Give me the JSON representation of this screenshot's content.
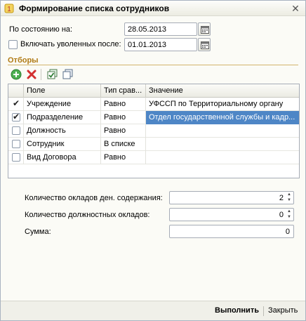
{
  "window": {
    "title": "Формирование списка сотрудников",
    "close_icon": "close-icon"
  },
  "form": {
    "state_date_label": "По состоянию на:",
    "state_date_value": "28.05.2013",
    "include_dismissed_label": "Включать уволенных после:",
    "include_dismissed_checked": false,
    "dismissed_date_value": "01.01.2013"
  },
  "filters": {
    "section_title": "Отборы",
    "toolbar": {
      "add_icon": "add-icon",
      "delete_icon": "delete-icon",
      "check_all_icon": "check-all-icon",
      "uncheck_all_icon": "uncheck-all-icon"
    },
    "columns": [
      "Поле",
      "Тип срав...",
      "Значение"
    ],
    "rows": [
      {
        "checked": true,
        "field": "Учреждение",
        "compare": "Равно",
        "value": "УФССП по Территориальному органу"
      },
      {
        "checked": true,
        "field": "Подразделение",
        "compare": "Равно",
        "value": "Отдел государственной службы и кадр..."
      },
      {
        "checked": false,
        "field": "Должность",
        "compare": "Равно",
        "value": ""
      },
      {
        "checked": false,
        "field": "Сотрудник",
        "compare": "В списке",
        "value": ""
      },
      {
        "checked": false,
        "field": "Вид Договора",
        "compare": "Равно",
        "value": ""
      }
    ],
    "selected_row": 1
  },
  "params": {
    "salaries_label": "Количество окладов ден. содержания:",
    "salaries_value": "2",
    "positions_label": "Количество должностных окладов:",
    "positions_value": "0",
    "sum_label": "Сумма:",
    "sum_value": "0"
  },
  "footer": {
    "run_label": "Выполнить",
    "close_label": "Закрыть"
  },
  "colors": {
    "accent": "#b07a14",
    "selection": "#4e86c6"
  }
}
